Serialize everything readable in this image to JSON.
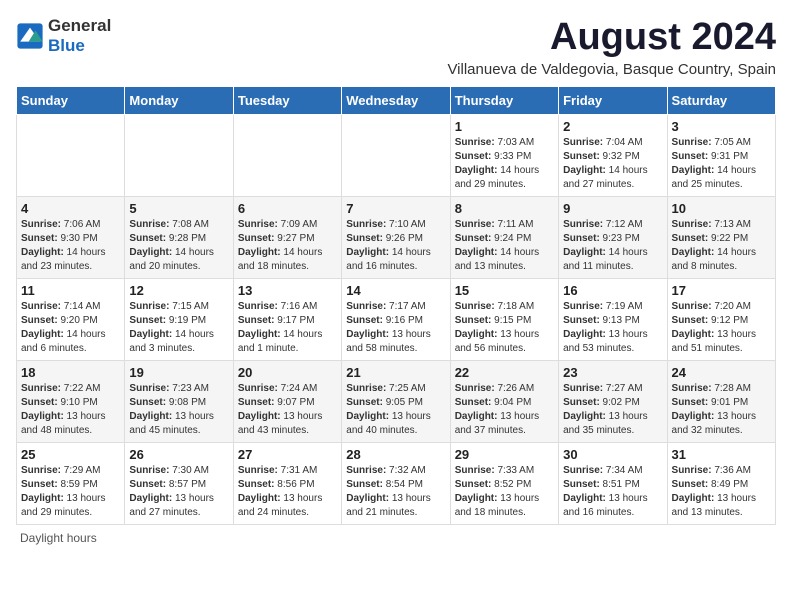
{
  "header": {
    "logo_general": "General",
    "logo_blue": "Blue",
    "title": "August 2024",
    "subtitle": "Villanueva de Valdegovia, Basque Country, Spain"
  },
  "weekdays": [
    "Sunday",
    "Monday",
    "Tuesday",
    "Wednesday",
    "Thursday",
    "Friday",
    "Saturday"
  ],
  "weeks": [
    [
      {
        "day": "",
        "info": ""
      },
      {
        "day": "",
        "info": ""
      },
      {
        "day": "",
        "info": ""
      },
      {
        "day": "",
        "info": ""
      },
      {
        "day": "1",
        "info": "Sunrise: 7:03 AM\nSunset: 9:33 PM\nDaylight: 14 hours and 29 minutes."
      },
      {
        "day": "2",
        "info": "Sunrise: 7:04 AM\nSunset: 9:32 PM\nDaylight: 14 hours and 27 minutes."
      },
      {
        "day": "3",
        "info": "Sunrise: 7:05 AM\nSunset: 9:31 PM\nDaylight: 14 hours and 25 minutes."
      }
    ],
    [
      {
        "day": "4",
        "info": "Sunrise: 7:06 AM\nSunset: 9:30 PM\nDaylight: 14 hours and 23 minutes."
      },
      {
        "day": "5",
        "info": "Sunrise: 7:08 AM\nSunset: 9:28 PM\nDaylight: 14 hours and 20 minutes."
      },
      {
        "day": "6",
        "info": "Sunrise: 7:09 AM\nSunset: 9:27 PM\nDaylight: 14 hours and 18 minutes."
      },
      {
        "day": "7",
        "info": "Sunrise: 7:10 AM\nSunset: 9:26 PM\nDaylight: 14 hours and 16 minutes."
      },
      {
        "day": "8",
        "info": "Sunrise: 7:11 AM\nSunset: 9:24 PM\nDaylight: 14 hours and 13 minutes."
      },
      {
        "day": "9",
        "info": "Sunrise: 7:12 AM\nSunset: 9:23 PM\nDaylight: 14 hours and 11 minutes."
      },
      {
        "day": "10",
        "info": "Sunrise: 7:13 AM\nSunset: 9:22 PM\nDaylight: 14 hours and 8 minutes."
      }
    ],
    [
      {
        "day": "11",
        "info": "Sunrise: 7:14 AM\nSunset: 9:20 PM\nDaylight: 14 hours and 6 minutes."
      },
      {
        "day": "12",
        "info": "Sunrise: 7:15 AM\nSunset: 9:19 PM\nDaylight: 14 hours and 3 minutes."
      },
      {
        "day": "13",
        "info": "Sunrise: 7:16 AM\nSunset: 9:17 PM\nDaylight: 14 hours and 1 minute."
      },
      {
        "day": "14",
        "info": "Sunrise: 7:17 AM\nSunset: 9:16 PM\nDaylight: 13 hours and 58 minutes."
      },
      {
        "day": "15",
        "info": "Sunrise: 7:18 AM\nSunset: 9:15 PM\nDaylight: 13 hours and 56 minutes."
      },
      {
        "day": "16",
        "info": "Sunrise: 7:19 AM\nSunset: 9:13 PM\nDaylight: 13 hours and 53 minutes."
      },
      {
        "day": "17",
        "info": "Sunrise: 7:20 AM\nSunset: 9:12 PM\nDaylight: 13 hours and 51 minutes."
      }
    ],
    [
      {
        "day": "18",
        "info": "Sunrise: 7:22 AM\nSunset: 9:10 PM\nDaylight: 13 hours and 48 minutes."
      },
      {
        "day": "19",
        "info": "Sunrise: 7:23 AM\nSunset: 9:08 PM\nDaylight: 13 hours and 45 minutes."
      },
      {
        "day": "20",
        "info": "Sunrise: 7:24 AM\nSunset: 9:07 PM\nDaylight: 13 hours and 43 minutes."
      },
      {
        "day": "21",
        "info": "Sunrise: 7:25 AM\nSunset: 9:05 PM\nDaylight: 13 hours and 40 minutes."
      },
      {
        "day": "22",
        "info": "Sunrise: 7:26 AM\nSunset: 9:04 PM\nDaylight: 13 hours and 37 minutes."
      },
      {
        "day": "23",
        "info": "Sunrise: 7:27 AM\nSunset: 9:02 PM\nDaylight: 13 hours and 35 minutes."
      },
      {
        "day": "24",
        "info": "Sunrise: 7:28 AM\nSunset: 9:01 PM\nDaylight: 13 hours and 32 minutes."
      }
    ],
    [
      {
        "day": "25",
        "info": "Sunrise: 7:29 AM\nSunset: 8:59 PM\nDaylight: 13 hours and 29 minutes."
      },
      {
        "day": "26",
        "info": "Sunrise: 7:30 AM\nSunset: 8:57 PM\nDaylight: 13 hours and 27 minutes."
      },
      {
        "day": "27",
        "info": "Sunrise: 7:31 AM\nSunset: 8:56 PM\nDaylight: 13 hours and 24 minutes."
      },
      {
        "day": "28",
        "info": "Sunrise: 7:32 AM\nSunset: 8:54 PM\nDaylight: 13 hours and 21 minutes."
      },
      {
        "day": "29",
        "info": "Sunrise: 7:33 AM\nSunset: 8:52 PM\nDaylight: 13 hours and 18 minutes."
      },
      {
        "day": "30",
        "info": "Sunrise: 7:34 AM\nSunset: 8:51 PM\nDaylight: 13 hours and 16 minutes."
      },
      {
        "day": "31",
        "info": "Sunrise: 7:36 AM\nSunset: 8:49 PM\nDaylight: 13 hours and 13 minutes."
      }
    ]
  ],
  "footer": "Daylight hours"
}
